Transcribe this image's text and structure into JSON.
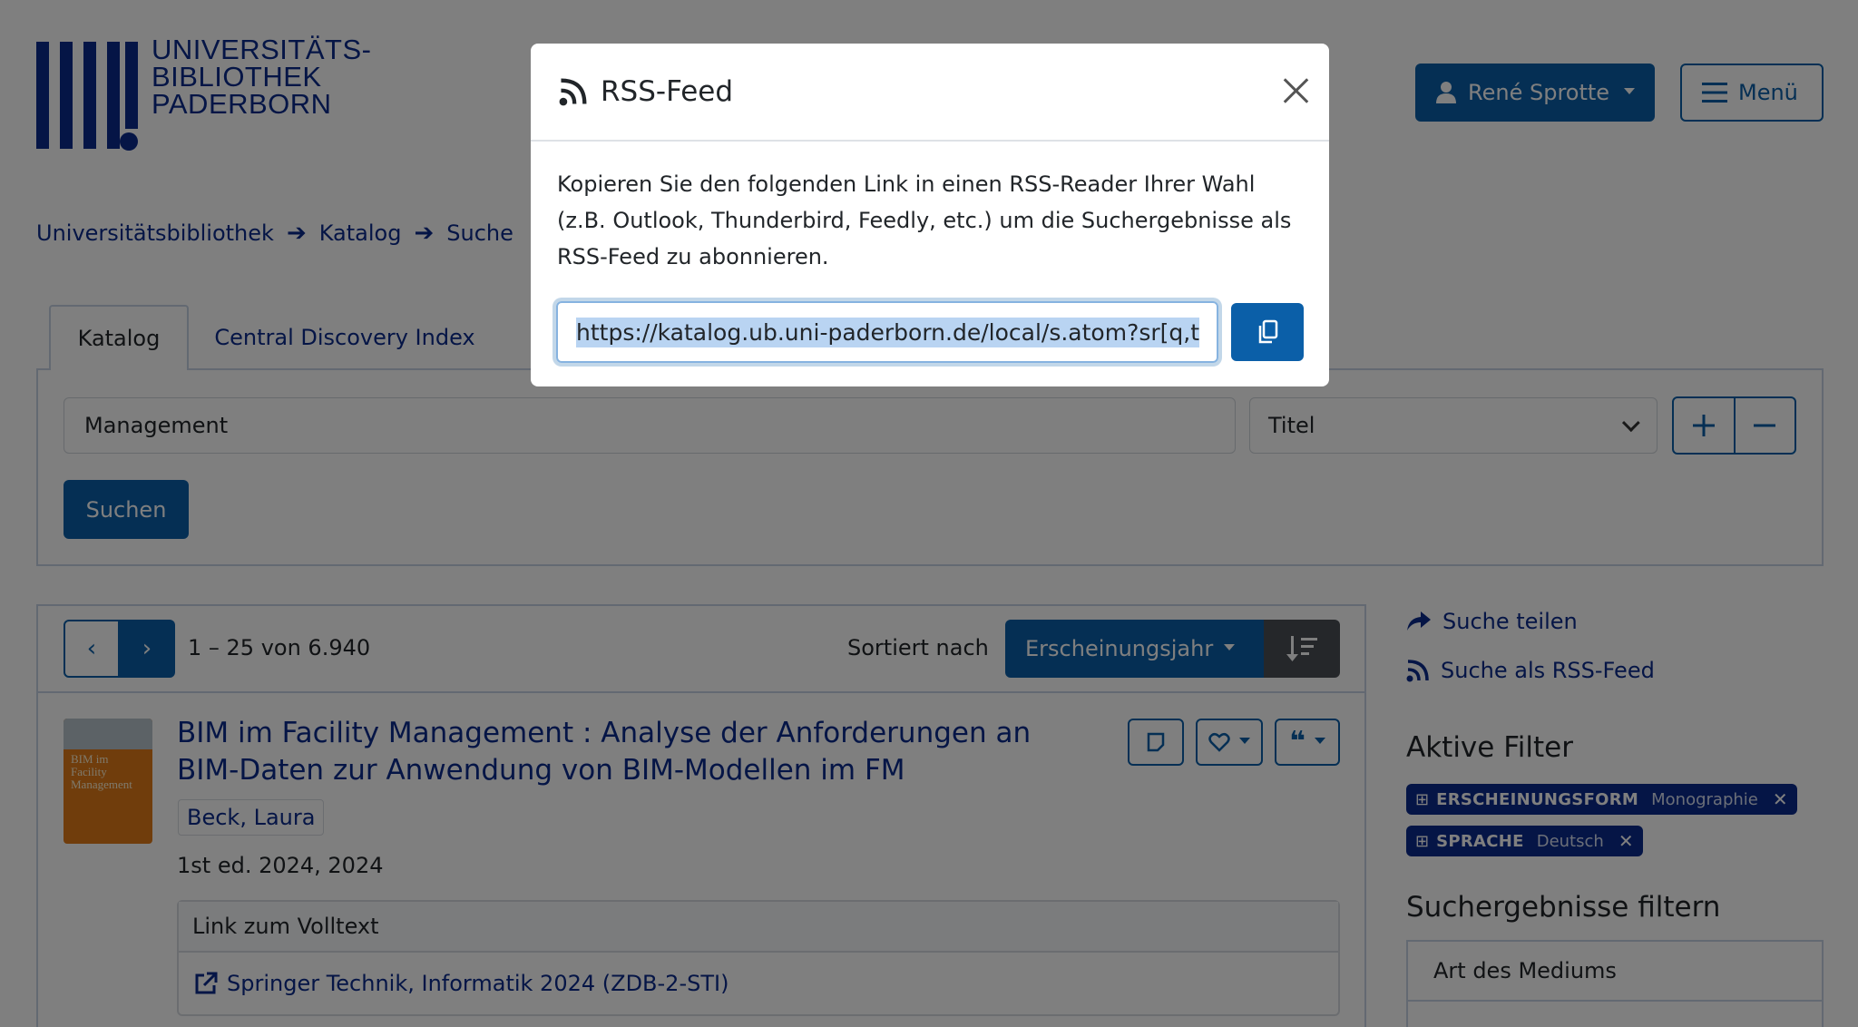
{
  "header": {
    "logo_lines": [
      "UNIVERSITÄTS-",
      "BIBLIOTHEK",
      "PADERBORN"
    ],
    "user_label": "René Sprotte",
    "menu_label": "Menü"
  },
  "breadcrumb": [
    "Universitätsbibliothek",
    "Katalog",
    "Suche"
  ],
  "search": {
    "tabs": [
      "Katalog",
      "Central Discovery Index"
    ],
    "query_value": "Management",
    "field_selected": "Titel",
    "submit_label": "Suchen"
  },
  "results": {
    "count_text": "1 – 25 von 6.940",
    "sort_label": "Sortiert nach",
    "sort_value": "Erscheinungsjahr",
    "item": {
      "cover_text": "BIM im Facility Management",
      "title": "BIM im Facility Management : Analyse der Anforderungen an BIM-Daten zur Anwendung von BIM-Modellen im FM",
      "author": "Beck, Laura",
      "edition": "1st ed. 2024, 2024",
      "fulltext_header": "Link zum Volltext",
      "fulltext_link": "Springer Technik, Informatik 2024 (ZDB-2-STI)"
    }
  },
  "sidebar": {
    "share_label": "Suche teilen",
    "rss_label": "Suche als RSS-Feed",
    "active_filters_heading": "Aktive Filter",
    "filters": [
      {
        "name": "ERSCHEINUNGSFORM",
        "value": "Monographie"
      },
      {
        "name": "SPRACHE",
        "value": "Deutsch"
      }
    ],
    "refine_heading": "Suchergebnisse filtern",
    "facet_first": "Art des Mediums"
  },
  "modal": {
    "title": "RSS-Feed",
    "text": "Kopieren Sie den folgenden Link in einen RSS-Reader Ihrer Wahl (z.B. Outlook, Thunderbird, Feedly, etc.) um die Suchergebnisse als RSS-Feed zu abonnieren.",
    "url": "https://katalog.ub.uni-paderborn.de/local/s.atom?sr[q,t"
  },
  "colors": {
    "brand_blue": "#0b2a8c",
    "primary": "#0b5fa8",
    "overlay": "rgba(0,0,0,0.5)"
  },
  "icons": [
    "user-icon",
    "hamburger-icon",
    "arrow-right-icon",
    "plus-icon",
    "minus-icon",
    "chevron-left-icon",
    "chevron-right-icon",
    "sort-desc-icon",
    "note-icon",
    "heart-icon",
    "quote-icon",
    "external-link-icon",
    "share-icon",
    "rss-icon",
    "close-icon",
    "copy-icon"
  ]
}
